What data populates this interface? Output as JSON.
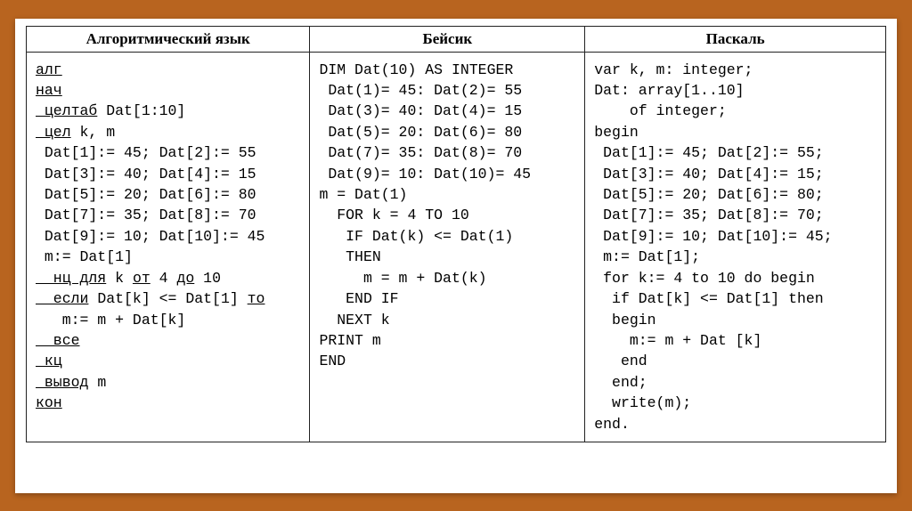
{
  "headers": {
    "alg": "Алгоритмический язык",
    "basic": "Бейсик",
    "pascal": "Паскаль"
  },
  "alg": {
    "l01a": "алг",
    "l02a": "нач",
    "l03a": " целтаб",
    "l03b": " Dat[1:10]",
    "l04a": " цел",
    "l04b": " k, m",
    "l05": " Dat[1]:= 45; Dat[2]:= 55",
    "l06": " Dat[3]:= 40; Dat[4]:= 15",
    "l07": " Dat[5]:= 20; Dat[6]:= 80",
    "l08": " Dat[7]:= 35; Dat[8]:= 70",
    "l09": " Dat[9]:= 10; Dat[10]:= 45",
    "l10": " m:= Dat[1]",
    "l11a": "  нц для",
    "l11b": " k ",
    "l11c": "от",
    "l11d": " 4 ",
    "l11e": "до",
    "l11f": " 10",
    "l12a": "  если",
    "l12b": " Dat[k] <= Dat[1] ",
    "l12c": "то",
    "l13": "   m:= m + Dat[k]",
    "l14a": "  все",
    "l15a": " кц",
    "l16a": " вывод",
    "l16b": " m",
    "l17a": "кон"
  },
  "basic": {
    "l01": "DIM Dat(10) AS INTEGER",
    "l02": " Dat(1)= 45: Dat(2)= 55",
    "l03": " Dat(3)= 40: Dat(4)= 15",
    "l04": " Dat(5)= 20: Dat(6)= 80",
    "l05": " Dat(7)= 35: Dat(8)= 70",
    "l06": " Dat(9)= 10: Dat(10)= 45",
    "l07": "m = Dat(1)",
    "l08": "  FOR k = 4 TO 10",
    "l09": "   IF Dat(k) <= Dat(1)",
    "l10": "   THEN",
    "l11": "     m = m + Dat(k)",
    "l12": "   END IF",
    "l13": "  NEXT k",
    "l14": "PRINT m",
    "l15": "END"
  },
  "pascal": {
    "l01": "var k, m: integer;",
    "l02": "Dat: array[1..10]",
    "l03": "    of integer;",
    "l04": "begin",
    "l05": " Dat[1]:= 45; Dat[2]:= 55;",
    "l06": " Dat[3]:= 40; Dat[4]:= 15;",
    "l07": " Dat[5]:= 20; Dat[6]:= 80;",
    "l08": " Dat[7]:= 35; Dat[8]:= 70;",
    "l09": " Dat[9]:= 10; Dat[10]:= 45;",
    "l10": " m:= Dat[1];",
    "l11": " for k:= 4 to 10 do begin",
    "l12": "  if Dat[k] <= Dat[1] then",
    "l13": "  begin",
    "l14": "    m:= m + Dat [k]",
    "l15": "   end",
    "l16": "  end;",
    "l17": "  write(m);",
    "l18": "end."
  }
}
